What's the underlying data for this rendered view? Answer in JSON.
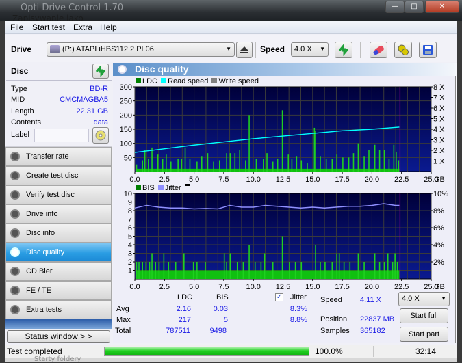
{
  "window": {
    "title": "Opti Drive Control 1.70",
    "behind_title": "Zapisywanie jako",
    "controls": {
      "minimize": "—",
      "maximize": "□",
      "close": "✕"
    }
  },
  "menu": [
    "File",
    "Start test",
    "Extra",
    "Help"
  ],
  "toolbar": {
    "drive_label": "Drive",
    "drive_value": "(P:)   ATAPI iHBS112   2 PL06",
    "speed_label": "Speed",
    "speed_value": "4.0 X",
    "icons": [
      "eject-icon",
      "refresh-icon",
      "erase-icon",
      "settings-icon",
      "save-icon"
    ]
  },
  "disc": {
    "header": "Disc",
    "rows": [
      {
        "label": "Type",
        "value": "BD-R"
      },
      {
        "label": "MID",
        "value": "CMCMAGBA5"
      },
      {
        "label": "Length",
        "value": "22.31 GB"
      },
      {
        "label": "Contents",
        "value": "data"
      }
    ],
    "label_field": {
      "label": "Label",
      "value": ""
    }
  },
  "nav": [
    {
      "label": "Transfer rate",
      "active": false
    },
    {
      "label": "Create test disc",
      "active": false
    },
    {
      "label": "Verify test disc",
      "active": false
    },
    {
      "label": "Drive info",
      "active": false
    },
    {
      "label": "Disc info",
      "active": false
    },
    {
      "label": "Disc quality",
      "active": true
    },
    {
      "label": "CD Bler",
      "active": false
    },
    {
      "label": "FE / TE",
      "active": false
    },
    {
      "label": "Extra tests",
      "active": false
    }
  ],
  "status_window_button": "Status window > >",
  "panel_title": "Disc quality",
  "colors": {
    "ldc": "#00c000",
    "read_speed": "#00ffff",
    "write_speed": "#808080",
    "bis": "#00c000",
    "jitter": "#9090ff",
    "end_marker": "#a000a0",
    "value_blue": "#1a1ae6",
    "nav_active": "#2a9de3",
    "progress": "#10c010"
  },
  "chart_data": [
    {
      "type": "bar",
      "title": "LDC / Read speed",
      "legend": [
        "LDC",
        "Read speed",
        "Write speed"
      ],
      "legend_position": "top-left",
      "xlabel": "GB",
      "x_ticks": [
        "0.0",
        "2.5",
        "5.0",
        "7.5",
        "10.0",
        "12.5",
        "15.0",
        "17.5",
        "20.0",
        "22.5",
        "25.0"
      ],
      "xlim": [
        0,
        25
      ],
      "y_ticks": [
        "50",
        "100",
        "150",
        "200",
        "250",
        "300"
      ],
      "ylim": [
        0,
        300
      ],
      "y2_ticks": [
        "1 X",
        "2 X",
        "3 X",
        "4 X",
        "5 X",
        "6 X",
        "7 X",
        "8 X"
      ],
      "y2lim": [
        0,
        8
      ],
      "grid": true,
      "end_marker_gb": 22.31,
      "ldc_spikes": [
        {
          "x": 0.1,
          "y": 25
        },
        {
          "x": 0.6,
          "y": 40
        },
        {
          "x": 0.8,
          "y": 75
        },
        {
          "x": 1.1,
          "y": 45
        },
        {
          "x": 1.4,
          "y": 85
        },
        {
          "x": 1.9,
          "y": 60
        },
        {
          "x": 2.3,
          "y": 45
        },
        {
          "x": 2.6,
          "y": 60
        },
        {
          "x": 3.0,
          "y": 35
        },
        {
          "x": 3.6,
          "y": 45
        },
        {
          "x": 3.9,
          "y": 45
        },
        {
          "x": 4.2,
          "y": 85
        },
        {
          "x": 4.6,
          "y": 45
        },
        {
          "x": 5.2,
          "y": 35
        },
        {
          "x": 5.6,
          "y": 55
        },
        {
          "x": 6.1,
          "y": 65
        },
        {
          "x": 6.6,
          "y": 35
        },
        {
          "x": 7.1,
          "y": 40
        },
        {
          "x": 7.7,
          "y": 65
        },
        {
          "x": 8.0,
          "y": 65
        },
        {
          "x": 8.4,
          "y": 65
        },
        {
          "x": 8.8,
          "y": 75
        },
        {
          "x": 9.3,
          "y": 40
        },
        {
          "x": 9.6,
          "y": 200
        },
        {
          "x": 10.2,
          "y": 45
        },
        {
          "x": 10.8,
          "y": 45
        },
        {
          "x": 11.1,
          "y": 65
        },
        {
          "x": 11.6,
          "y": 35
        },
        {
          "x": 12.0,
          "y": 45
        },
        {
          "x": 12.4,
          "y": 217
        },
        {
          "x": 12.9,
          "y": 60
        },
        {
          "x": 13.2,
          "y": 45
        },
        {
          "x": 13.6,
          "y": 55
        },
        {
          "x": 14.0,
          "y": 40
        },
        {
          "x": 14.5,
          "y": 30
        },
        {
          "x": 15.1,
          "y": 155
        },
        {
          "x": 15.2,
          "y": 145
        },
        {
          "x": 15.6,
          "y": 55
        },
        {
          "x": 16.1,
          "y": 45
        },
        {
          "x": 16.6,
          "y": 45
        },
        {
          "x": 17.0,
          "y": 60
        },
        {
          "x": 17.5,
          "y": 50
        },
        {
          "x": 18.0,
          "y": 50
        },
        {
          "x": 18.4,
          "y": 65
        },
        {
          "x": 18.8,
          "y": 100
        },
        {
          "x": 19.3,
          "y": 55
        },
        {
          "x": 19.7,
          "y": 75
        },
        {
          "x": 20.2,
          "y": 95
        },
        {
          "x": 20.6,
          "y": 75
        },
        {
          "x": 21.0,
          "y": 75
        },
        {
          "x": 21.4,
          "y": 45
        },
        {
          "x": 21.8,
          "y": 95
        },
        {
          "x": 22.0,
          "y": 70
        },
        {
          "x": 22.2,
          "y": 40
        }
      ],
      "ldc_baseline": 10,
      "read_speed_x": [
        0,
        2.5,
        5,
        7.5,
        10,
        12.5,
        15,
        17.5,
        20,
        22.31
      ],
      "read_speed_y": [
        1.8,
        2.15,
        2.5,
        2.8,
        3.1,
        3.35,
        3.6,
        3.85,
        4.0,
        4.2
      ]
    },
    {
      "type": "bar",
      "title": "BIS / Jitter",
      "legend": [
        "BIS",
        "Jitter"
      ],
      "legend_position": "top-left",
      "xlabel": "GB",
      "x_ticks": [
        "0.0",
        "2.5",
        "5.0",
        "7.5",
        "10.0",
        "12.5",
        "15.0",
        "17.5",
        "20.0",
        "22.5",
        "25.0"
      ],
      "xlim": [
        0,
        25
      ],
      "y_ticks": [
        "1",
        "2",
        "3",
        "4",
        "5",
        "6",
        "7",
        "8",
        "9",
        "10"
      ],
      "ylim": [
        0,
        10
      ],
      "y2_ticks": [
        "2%",
        "4%",
        "6%",
        "8%",
        "10%"
      ],
      "y2lim": [
        0,
        10
      ],
      "grid": true,
      "end_marker_gb": 22.31,
      "bis_baseline": 1,
      "bis_spikes": [
        {
          "x": 0.1,
          "y": 2
        },
        {
          "x": 0.3,
          "y": 2
        },
        {
          "x": 0.6,
          "y": 2
        },
        {
          "x": 0.9,
          "y": 2
        },
        {
          "x": 1.2,
          "y": 2
        },
        {
          "x": 1.4,
          "y": 3
        },
        {
          "x": 1.7,
          "y": 2
        },
        {
          "x": 2.0,
          "y": 2
        },
        {
          "x": 2.4,
          "y": 3
        },
        {
          "x": 2.8,
          "y": 2
        },
        {
          "x": 3.4,
          "y": 2
        },
        {
          "x": 4.1,
          "y": 3
        },
        {
          "x": 4.9,
          "y": 2
        },
        {
          "x": 5.2,
          "y": 2
        },
        {
          "x": 5.9,
          "y": 2
        },
        {
          "x": 7.5,
          "y": 3
        },
        {
          "x": 7.7,
          "y": 2
        },
        {
          "x": 8.0,
          "y": 3
        },
        {
          "x": 8.6,
          "y": 2
        },
        {
          "x": 9.1,
          "y": 2
        },
        {
          "x": 9.6,
          "y": 4
        },
        {
          "x": 10.1,
          "y": 2
        },
        {
          "x": 10.6,
          "y": 2
        },
        {
          "x": 10.9,
          "y": 3
        },
        {
          "x": 11.6,
          "y": 2
        },
        {
          "x": 12.4,
          "y": 5
        },
        {
          "x": 13.0,
          "y": 2
        },
        {
          "x": 13.5,
          "y": 2
        },
        {
          "x": 14.0,
          "y": 2
        },
        {
          "x": 15.2,
          "y": 4
        },
        {
          "x": 15.6,
          "y": 2
        },
        {
          "x": 16.0,
          "y": 2
        },
        {
          "x": 16.6,
          "y": 2
        },
        {
          "x": 17.0,
          "y": 3
        },
        {
          "x": 17.2,
          "y": 3
        },
        {
          "x": 17.6,
          "y": 2
        },
        {
          "x": 18.1,
          "y": 2
        },
        {
          "x": 18.8,
          "y": 3
        },
        {
          "x": 19.3,
          "y": 2
        },
        {
          "x": 20.2,
          "y": 3
        },
        {
          "x": 20.6,
          "y": 2
        },
        {
          "x": 21.0,
          "y": 2
        },
        {
          "x": 21.3,
          "y": 3
        },
        {
          "x": 21.7,
          "y": 2
        },
        {
          "x": 21.9,
          "y": 3
        },
        {
          "x": 22.1,
          "y": 2
        }
      ],
      "jitter_x": [
        0,
        1,
        2,
        3,
        4,
        5,
        6,
        7,
        8,
        9,
        10,
        11,
        12,
        13,
        14,
        15,
        16,
        17,
        18,
        19,
        20,
        21,
        22,
        22.31
      ],
      "jitter_y": [
        8.3,
        8.6,
        8.4,
        8.3,
        8.3,
        8.2,
        8.25,
        8.2,
        8.6,
        8.4,
        8.4,
        8.6,
        8.5,
        8.4,
        8.3,
        8.4,
        8.3,
        8.4,
        8.5,
        8.5,
        8.6,
        8.8,
        8.6,
        8.6
      ]
    }
  ],
  "stats": {
    "headers": [
      "LDC",
      "BIS"
    ],
    "rows": [
      {
        "label": "Avg",
        "ldc": "2.16",
        "bis": "0.03",
        "jitter": "8.3%"
      },
      {
        "label": "Max",
        "ldc": "217",
        "bis": "5",
        "jitter": "8.8%"
      },
      {
        "label": "Total",
        "ldc": "787511",
        "bis": "9498",
        "jitter": ""
      }
    ],
    "jitter_label": "Jitter",
    "jitter_checked": true
  },
  "info": {
    "speed_label": "Speed",
    "speed_value": "4.11 X",
    "position_label": "Position",
    "position_value": "22837 MB",
    "samples_label": "Samples",
    "samples_value": "365182",
    "speed_select": "4.0 X",
    "start_full": "Start full",
    "start_part": "Start part"
  },
  "statusbar": {
    "text": "Test completed",
    "progress_percent": 100.0,
    "progress_label": "100.0%",
    "time": "32:14"
  },
  "behind_text": "Starty foldery"
}
